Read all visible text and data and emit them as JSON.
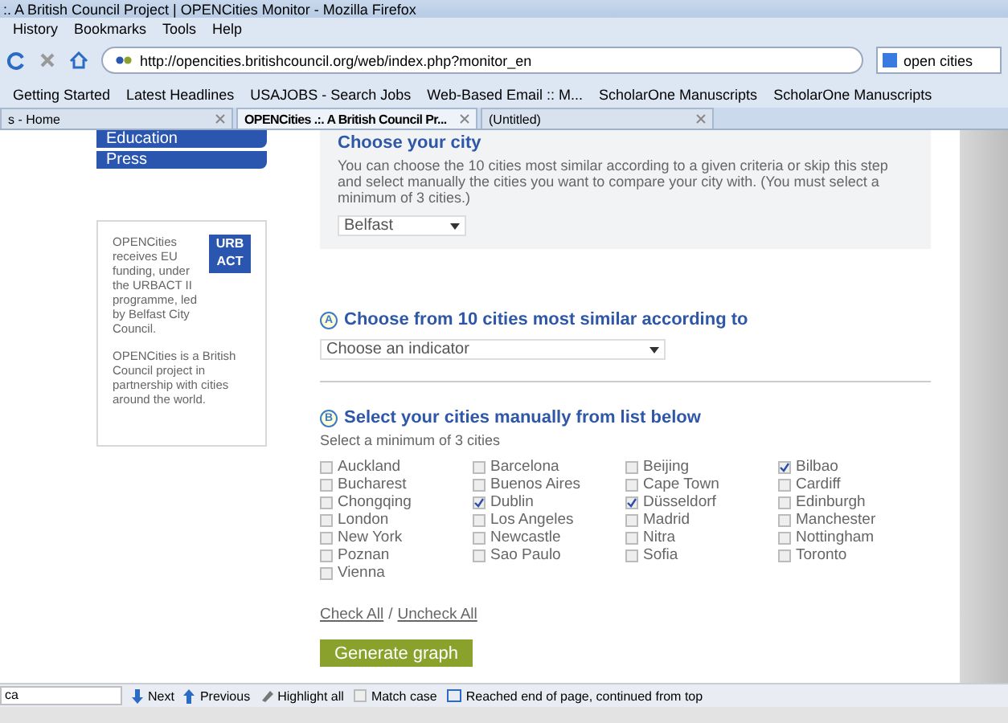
{
  "window": {
    "title": ":. A British Council Project | OPENCities Monitor - Mozilla Firefox"
  },
  "menu": [
    "History",
    "Bookmarks",
    "Tools",
    "Help"
  ],
  "address": {
    "url": "http://opencities.britishcouncil.org/web/index.php?monitor_en",
    "search": "open cities"
  },
  "bookmarks": [
    "Getting Started",
    "Latest Headlines",
    "USAJOBS - Search Jobs",
    "Web-Based Email :: M...",
    "ScholarOne Manuscripts",
    "ScholarOne Manuscripts"
  ],
  "tabs": [
    {
      "label": "s - Home",
      "selected": false
    },
    {
      "label": "OPENCities .:. A British Council Pr...",
      "selected": true
    },
    {
      "label": "(Untitled)",
      "selected": false
    }
  ],
  "sidebar": {
    "nav": [
      "Education",
      "Press"
    ],
    "info": [
      "OPENCities receives EU funding, under the URBACT II programme, led by Belfast City Council.",
      "OPENCities is a British Council project in partnership with cities around the world."
    ],
    "logo": [
      "URB",
      "ACT"
    ]
  },
  "choose_city": {
    "title": "Choose your city",
    "text": "You can choose the 10 cities most similar according to a given criteria or skip this step and select manually the cities you want to compare your city with. (You must select a minimum of 3 cities.)",
    "city": "Belfast"
  },
  "section_a": {
    "badge": "A",
    "title": "Choose from 10 cities most similar according to",
    "indicator": "Choose an indicator"
  },
  "section_b": {
    "badge": "B",
    "title": "Select your cities manually from list below",
    "hint": "Select a minimum of 3 cities",
    "columns": [
      [
        {
          "label": "Auckland",
          "checked": false
        },
        {
          "label": "Bucharest",
          "checked": false
        },
        {
          "label": "Chongqing",
          "checked": false
        },
        {
          "label": "London",
          "checked": false
        },
        {
          "label": "New York",
          "checked": false
        },
        {
          "label": "Poznan",
          "checked": false
        },
        {
          "label": "Vienna",
          "checked": false
        }
      ],
      [
        {
          "label": "Barcelona",
          "checked": false
        },
        {
          "label": "Buenos Aires",
          "checked": false
        },
        {
          "label": "Dublin",
          "checked": true
        },
        {
          "label": "Los Angeles",
          "checked": false
        },
        {
          "label": "Newcastle",
          "checked": false
        },
        {
          "label": "Sao Paulo",
          "checked": false
        }
      ],
      [
        {
          "label": "Beijing",
          "checked": false
        },
        {
          "label": "Cape Town",
          "checked": false
        },
        {
          "label": "Düsseldorf",
          "checked": true
        },
        {
          "label": "Madrid",
          "checked": false
        },
        {
          "label": "Nitra",
          "checked": false
        },
        {
          "label": "Sofia",
          "checked": false
        }
      ],
      [
        {
          "label": "Bilbao",
          "checked": true
        },
        {
          "label": "Cardiff",
          "checked": false
        },
        {
          "label": "Edinburgh",
          "checked": false
        },
        {
          "label": "Manchester",
          "checked": false
        },
        {
          "label": "Nottingham",
          "checked": false
        },
        {
          "label": "Toronto",
          "checked": false
        }
      ]
    ],
    "check_all": "Check All",
    "separator": "/",
    "uncheck_all": "Uncheck All",
    "button": "Generate graph"
  },
  "find_bar": {
    "value": "ca",
    "next": "Next",
    "previous": "Previous",
    "highlight": "Highlight all",
    "match_case": {
      "label": "Match case",
      "checked": false
    },
    "status": "Reached end of page, continued from top"
  }
}
